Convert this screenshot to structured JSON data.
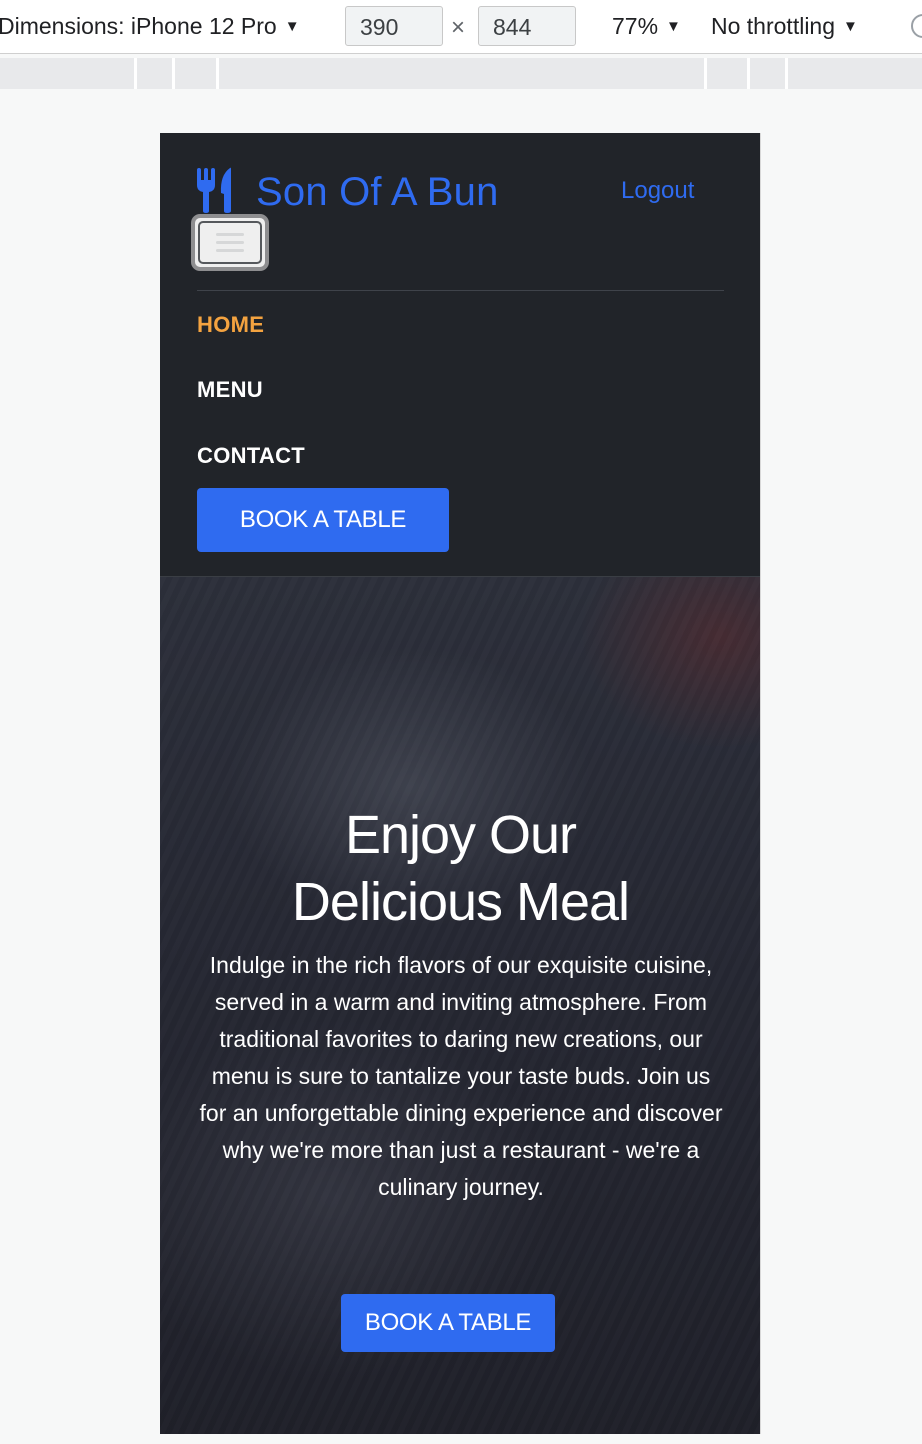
{
  "devtools": {
    "dimensions_label": "Dimensions: iPhone 12 Pro",
    "width": "390",
    "height": "844",
    "times": "×",
    "zoom": "77%",
    "throttling": "No throttling"
  },
  "navbar": {
    "brand": "Son Of A Bun",
    "logout": "Logout",
    "links": [
      "HOME",
      "MENU",
      "CONTACT"
    ],
    "active_link": "HOME",
    "book_button": "BOOK A TABLE"
  },
  "hero": {
    "title_line1": "Enjoy Our",
    "title_line2": "Delicious Meal",
    "text": "Indulge in the rich flavors of our exquisite cuisine, served in a warm and inviting atmosphere. From traditional favorites to daring new creations, our menu is sure to tantalize your taste buds. Join us for an unforgettable dining experience and discover why we're more than just a restaurant - we're a culinary journey.",
    "book_button": "BOOK A TABLE"
  },
  "colors": {
    "accent": "#2f6bf0",
    "active_nav": "#f4a340",
    "nav_bg": "#212429"
  },
  "icons": {
    "brand": "utensils-icon",
    "menu": "hamburger-icon"
  }
}
